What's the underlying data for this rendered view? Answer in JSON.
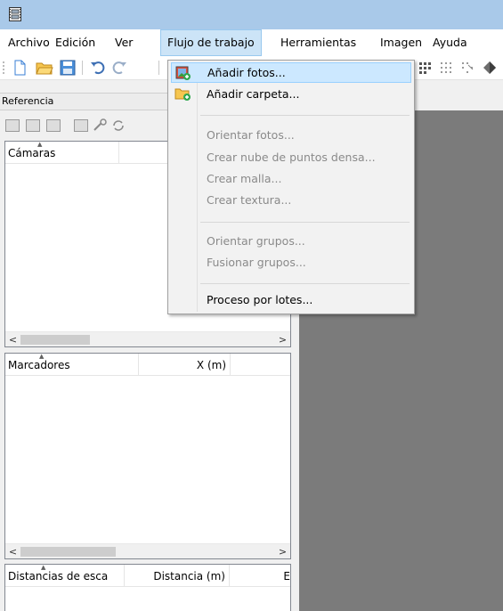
{
  "menubar": {
    "items": [
      "Archivo",
      "Edición",
      "Ver",
      "Flujo de trabajo",
      "Herramientas",
      "Imagen",
      "Ayuda"
    ]
  },
  "panel": {
    "title": "Referencia"
  },
  "cameras_table": {
    "columns": [
      "Cámaras"
    ]
  },
  "markers_table": {
    "columns": [
      "Marcadores",
      "X (m)"
    ]
  },
  "scalebars_table": {
    "columns": [
      "Distancias de esca",
      "Distancia (m)",
      "E"
    ]
  },
  "scroll": {
    "left": "<",
    "right": ">"
  },
  "workflow_menu": {
    "add_photos": "Añadir fotos...",
    "add_folder": "Añadir carpeta...",
    "align_photos": "Orientar fotos...",
    "dense_cloud": "Crear nube de puntos densa...",
    "mesh": "Crear malla...",
    "texture": "Crear textura...",
    "align_chunks": "Orientar grupos...",
    "merge_chunks": "Fusionar grupos...",
    "batch": "Proceso por lotes..."
  },
  "colors": {
    "titlebar": "#a9c9e9",
    "viewport": "#7b7b7b",
    "menu_highlight": "#cce8ff"
  }
}
